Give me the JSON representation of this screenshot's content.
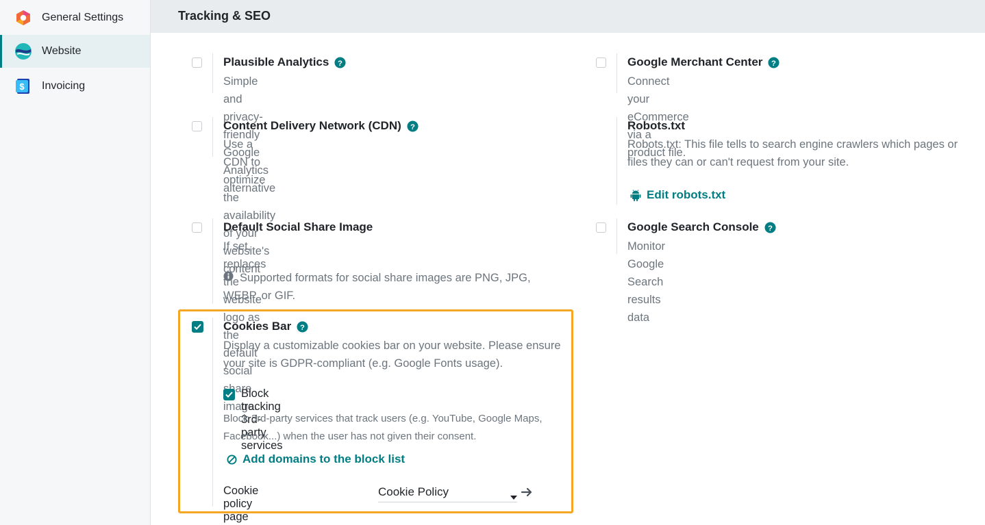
{
  "sidebar": {
    "items": [
      {
        "label": "General Settings",
        "icon": "general-settings-icon"
      },
      {
        "label": "Website",
        "icon": "website-app-icon",
        "active": true
      },
      {
        "label": "Invoicing",
        "icon": "invoicing-app-icon"
      }
    ]
  },
  "section": {
    "title": "Tracking & SEO"
  },
  "settings": {
    "plausible": {
      "title": "Plausible Analytics",
      "desc": "Simple and privacy-friendly Google Analytics alternative",
      "checked": false
    },
    "merchant": {
      "title": "Google Merchant Center",
      "desc": "Connect your eCommerce via a product file.",
      "checked": false
    },
    "cdn": {
      "title": "Content Delivery Network (CDN)",
      "desc": "Use a CDN to optimize the availability of your website's content",
      "checked": false
    },
    "robots": {
      "title": "Robots.txt",
      "desc": "Robots.txt: This file tells to search engine crawlers which pages or files they can or can't request from your site.",
      "link": "Edit robots.txt"
    },
    "social": {
      "title": "Default Social Share Image",
      "desc": "If set, replaces the website logo as the default social share image.",
      "info": "Supported formats for social share images are PNG, JPG, WEBP, or GIF.",
      "checked": false
    },
    "console": {
      "title": "Google Search Console",
      "desc": "Monitor Google Search results data",
      "checked": false
    },
    "cookies": {
      "title": "Cookies Bar",
      "desc": "Display a customizable cookies bar on your website. Please ensure your site is GDPR-compliant (e.g. Google Fonts usage).",
      "checked": true,
      "block_label": "Block tracking 3rd-party services",
      "block_checked": true,
      "block_desc": "Block 3rd-party services that track users (e.g. YouTube, Google Maps, Facebook...) when the user has not given their consent.",
      "add_domains_link": "Add domains to the block list",
      "policy_label": "Cookie policy page",
      "policy_value": "Cookie Policy"
    }
  },
  "colors": {
    "accent": "#017e84",
    "highlight": "#f5a623"
  }
}
